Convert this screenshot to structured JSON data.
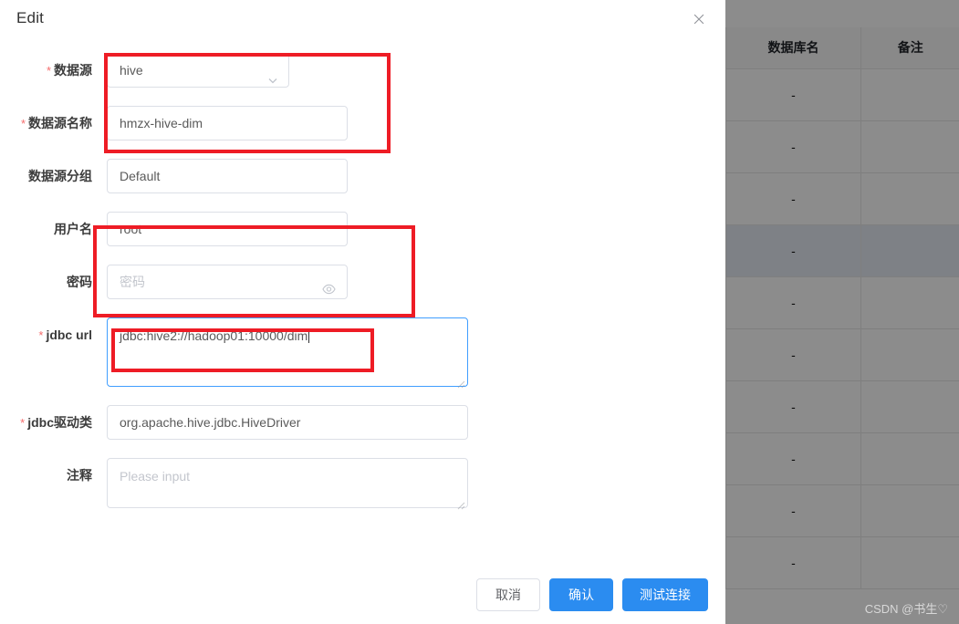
{
  "modal": {
    "title": "Edit",
    "close_icon": "close-icon"
  },
  "form": {
    "datasource": {
      "label": "数据源",
      "required": "*",
      "value": "hive",
      "icon": "chevron-down-icon"
    },
    "datasource_name": {
      "label": "数据源名称",
      "required": "*",
      "value": "hmzx-hive-dim"
    },
    "datasource_group": {
      "label": "数据源分组",
      "value": "Default"
    },
    "username": {
      "label": "用户名",
      "value": "root"
    },
    "password": {
      "label": "密码",
      "placeholder": "密码",
      "value": "",
      "icon": "eye-icon"
    },
    "jdbc_url": {
      "label": "jdbc url",
      "required": "*",
      "value": "jdbc:hive2://hadoop01:10000/dim"
    },
    "jdbc_driver": {
      "label": "jdbc驱动类",
      "required": "*",
      "value": "org.apache.hive.jdbc.HiveDriver"
    },
    "comment": {
      "label": "注释",
      "placeholder": "Please input",
      "value": ""
    }
  },
  "buttons": {
    "cancel": "取消",
    "confirm": "确认",
    "test_connection": "测试连接"
  },
  "background_table": {
    "columns": [
      "数据库名",
      "备注"
    ],
    "rows": [
      {
        "db_name": "-",
        "note": "",
        "hovered": false
      },
      {
        "db_name": "-",
        "note": "",
        "hovered": false
      },
      {
        "db_name": "-",
        "note": "",
        "hovered": false
      },
      {
        "db_name": "-",
        "note": "",
        "hovered": true
      },
      {
        "db_name": "-",
        "note": "",
        "hovered": false
      },
      {
        "db_name": "-",
        "note": "",
        "hovered": false
      },
      {
        "db_name": "-",
        "note": "",
        "hovered": false
      },
      {
        "db_name": "-",
        "note": "",
        "hovered": false
      },
      {
        "db_name": "-",
        "note": "",
        "hovered": false
      },
      {
        "db_name": "-",
        "note": "",
        "hovered": false
      }
    ]
  },
  "watermark": "CSDN @书生♡",
  "colors": {
    "primary": "#2b8cf0",
    "annotation": "#ee1c25",
    "focus_border": "#409eff",
    "required_star": "#f56c6c"
  }
}
